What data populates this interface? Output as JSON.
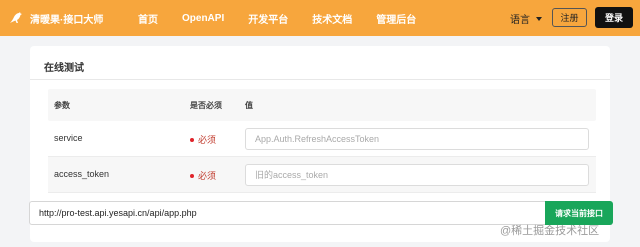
{
  "brand": {
    "name": "清暖果·接口大师",
    "logo_icon": "kangaroo-icon",
    "bar_color": "#f7a63d"
  },
  "nav": {
    "links": [
      "首页",
      "OpenAPI",
      "开发平台",
      "技术文档",
      "管理后台"
    ],
    "language": "语言",
    "register": "注册",
    "login": "登录"
  },
  "panel": {
    "title": "在线测试",
    "headers": {
      "param": "参数",
      "required": "是否必须",
      "value": "值"
    },
    "rows": [
      {
        "name": "service",
        "required": "必须",
        "value": "",
        "placeholder": "App.Auth.RefreshAccessToken"
      },
      {
        "name": "access_token",
        "required": "必须",
        "value": "",
        "placeholder": "旧的access_token"
      }
    ]
  },
  "request": {
    "url": "http://pro-test.api.yesapi.cn/api/app.php",
    "submit": "请求当前接口",
    "submit_color": "#19a65a"
  },
  "watermark": "@稀土掘金技术社区"
}
